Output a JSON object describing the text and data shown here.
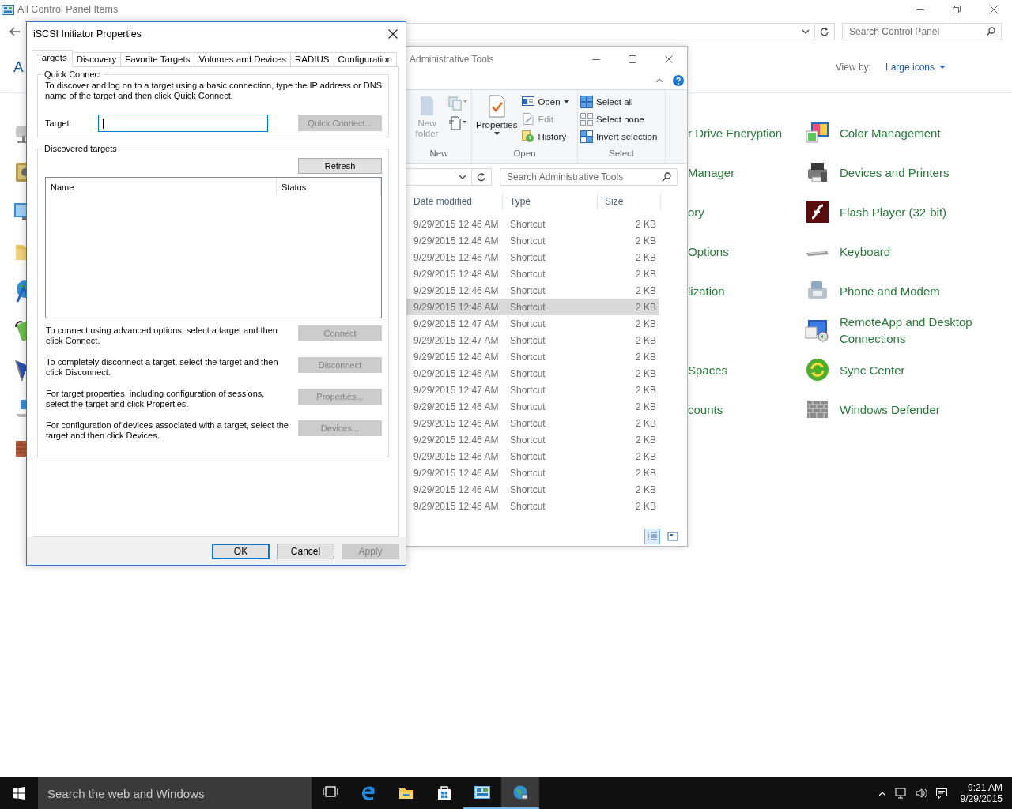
{
  "control_panel": {
    "title": "All Control Panel Items",
    "search": {
      "placeholder": "Search Control Panel"
    },
    "heading": "A",
    "view_by": {
      "label": "View by:",
      "value": "Large icons"
    },
    "rows": [
      {
        "column_2": "r Drive Encryption",
        "column_3": "Color Management"
      },
      {
        "column_2": "Manager",
        "column_3": "Devices and Printers"
      },
      {
        "column_2": "ory",
        "column_3": "Flash Player (32-bit)"
      },
      {
        "column_2": "Options",
        "column_3": "Keyboard"
      },
      {
        "column_2": "lization",
        "column_3": "Phone and Modem"
      },
      {
        "column_3": "RemoteApp and Desktop Connections"
      },
      {
        "column_2": "Spaces",
        "column_3": "Sync Center"
      },
      {
        "column_2": "counts",
        "column_3": "Windows Defender"
      }
    ]
  },
  "explorer": {
    "title": "Administrative Tools",
    "ribbon": [
      {
        "kind": "new",
        "label": "New",
        "large": {
          "label": "New folder",
          "disabled": true,
          "dropdown": false
        }
      },
      {
        "kind": "open",
        "label": "Open",
        "large": {
          "label": "Properties",
          "disabled": false,
          "dropdown": true
        },
        "commands": [
          {
            "label": "Open",
            "disabled": false,
            "dropdown": true
          },
          {
            "label": "Edit",
            "disabled": true,
            "dropdown": false
          },
          {
            "label": "History",
            "disabled": false,
            "dropdown": false
          }
        ]
      },
      {
        "kind": "select",
        "label": "Select",
        "commands": [
          {
            "label": "Select all",
            "disabled": false,
            "dropdown": false
          },
          {
            "label": "Select none",
            "disabled": false,
            "dropdown": false
          },
          {
            "label": "Invert selection",
            "disabled": false,
            "dropdown": false
          }
        ]
      }
    ],
    "search": {
      "placeholder": "Search Administrative Tools"
    },
    "columns": [
      "Date modified",
      "Type",
      "Size"
    ],
    "rows": [
      {
        "date_modified": "9/29/2015 12:46 AM",
        "type": "Shortcut",
        "size": "2 KB",
        "selected": false
      },
      {
        "date_modified": "9/29/2015 12:46 AM",
        "type": "Shortcut",
        "size": "2 KB",
        "selected": false
      },
      {
        "date_modified": "9/29/2015 12:46 AM",
        "type": "Shortcut",
        "size": "2 KB",
        "selected": false
      },
      {
        "date_modified": "9/29/2015 12:48 AM",
        "type": "Shortcut",
        "size": "2 KB",
        "selected": false
      },
      {
        "date_modified": "9/29/2015 12:46 AM",
        "type": "Shortcut",
        "size": "2 KB",
        "selected": false
      },
      {
        "date_modified": "9/29/2015 12:46 AM",
        "type": "Shortcut",
        "size": "2 KB",
        "selected": true
      },
      {
        "date_modified": "9/29/2015 12:47 AM",
        "type": "Shortcut",
        "size": "2 KB",
        "selected": false
      },
      {
        "date_modified": "9/29/2015 12:47 AM",
        "type": "Shortcut",
        "size": "2 KB",
        "selected": false
      },
      {
        "date_modified": "9/29/2015 12:46 AM",
        "type": "Shortcut",
        "size": "2 KB",
        "selected": false
      },
      {
        "date_modified": "9/29/2015 12:46 AM",
        "type": "Shortcut",
        "size": "2 KB",
        "selected": false
      },
      {
        "date_modified": "9/29/2015 12:47 AM",
        "type": "Shortcut",
        "size": "2 KB",
        "selected": false
      },
      {
        "date_modified": "9/29/2015 12:46 AM",
        "type": "Shortcut",
        "size": "2 KB",
        "selected": false
      },
      {
        "date_modified": "9/29/2015 12:46 AM",
        "type": "Shortcut",
        "size": "2 KB",
        "selected": false
      },
      {
        "date_modified": "9/29/2015 12:46 AM",
        "type": "Shortcut",
        "size": "2 KB",
        "selected": false
      },
      {
        "date_modified": "9/29/2015 12:46 AM",
        "type": "Shortcut",
        "size": "2 KB",
        "selected": false
      },
      {
        "date_modified": "9/29/2015 12:46 AM",
        "type": "Shortcut",
        "size": "2 KB",
        "selected": false
      },
      {
        "date_modified": "9/29/2015 12:46 AM",
        "type": "Shortcut",
        "size": "2 KB",
        "selected": false
      },
      {
        "date_modified": "9/29/2015 12:46 AM",
        "type": "Shortcut",
        "size": "2 KB",
        "selected": false
      }
    ],
    "views": [
      {
        "kind": "details",
        "selected": true
      },
      {
        "kind": "tiles",
        "selected": false
      }
    ]
  },
  "dialog": {
    "title": "iSCSI Initiator Properties",
    "tabs": [
      {
        "label": "Targets",
        "selected": true
      },
      {
        "label": "Discovery",
        "selected": false
      },
      {
        "label": "Favorite Targets",
        "selected": false
      },
      {
        "label": "Volumes and Devices",
        "selected": false
      },
      {
        "label": "RADIUS",
        "selected": false
      },
      {
        "label": "Configuration",
        "selected": false
      }
    ],
    "quick_connect": {
      "legend": "Quick Connect",
      "description": "To discover and log on to a target using a basic connection, type the IP address or DNS name of the target and then click Quick Connect.",
      "target_label": "Target:",
      "target_focused": true,
      "button": {
        "label": "Quick Connect...",
        "disabled": true
      }
    },
    "discovered": {
      "legend": "Discovered targets",
      "refresh": {
        "label": "Refresh",
        "disabled": false
      },
      "columns": [
        "Name",
        "Status"
      ],
      "actions": [
        {
          "description": "To connect using advanced options, select a target and then click Connect.",
          "button": {
            "label": "Connect",
            "disabled": true
          }
        },
        {
          "description": "To completely disconnect a target, select the target and then click Disconnect.",
          "button": {
            "label": "Disconnect",
            "disabled": true
          }
        },
        {
          "description": "For target properties, including configuration of sessions, select the target and click Properties.",
          "button": {
            "label": "Properties...",
            "disabled": true
          }
        },
        {
          "description": "For configuration of devices associated with a target, select the target and then click Devices.",
          "button": {
            "label": "Devices...",
            "disabled": true
          }
        }
      ]
    },
    "buttons": [
      {
        "label": "OK",
        "default": true,
        "disabled": false
      },
      {
        "label": "Cancel",
        "default": false,
        "disabled": false
      },
      {
        "label": "Apply",
        "default": false,
        "disabled": true
      }
    ]
  },
  "taskbar": {
    "search": {
      "placeholder": "Search the web and Windows"
    },
    "apps": [
      {
        "kind": "taskview",
        "running": false,
        "selected": false
      },
      {
        "kind": "edge",
        "running": false,
        "selected": false
      },
      {
        "kind": "explorer",
        "running": false,
        "selected": false
      },
      {
        "kind": "store",
        "running": false,
        "selected": false
      },
      {
        "kind": "controlpanel",
        "running": true,
        "selected": false
      },
      {
        "kind": "globe",
        "running": true,
        "selected": true
      }
    ],
    "time": "9:21 AM",
    "date": "9/29/2015"
  }
}
